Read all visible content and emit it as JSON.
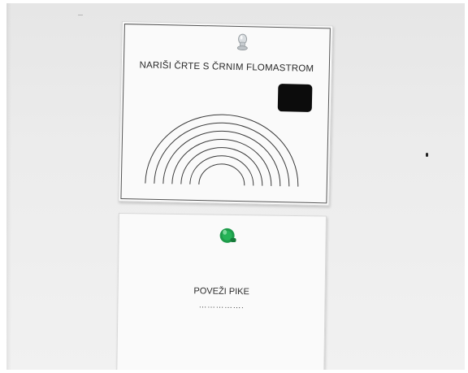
{
  "scene": {
    "wall_color": "#ebebeb",
    "paper_color": "#fafafa"
  },
  "top_sheet": {
    "title": "NARIŠI ČRTE S ČRNIM FLOMASTROM",
    "pin": "clear-push-pin",
    "arc_count": 7,
    "marker_color": "#0c0c0c"
  },
  "bottom_sheet": {
    "title": "POVEŽI PIKE",
    "dotted_line": "…………….",
    "pin": "green-push-pin",
    "pin_color": "#1e9b4a"
  }
}
